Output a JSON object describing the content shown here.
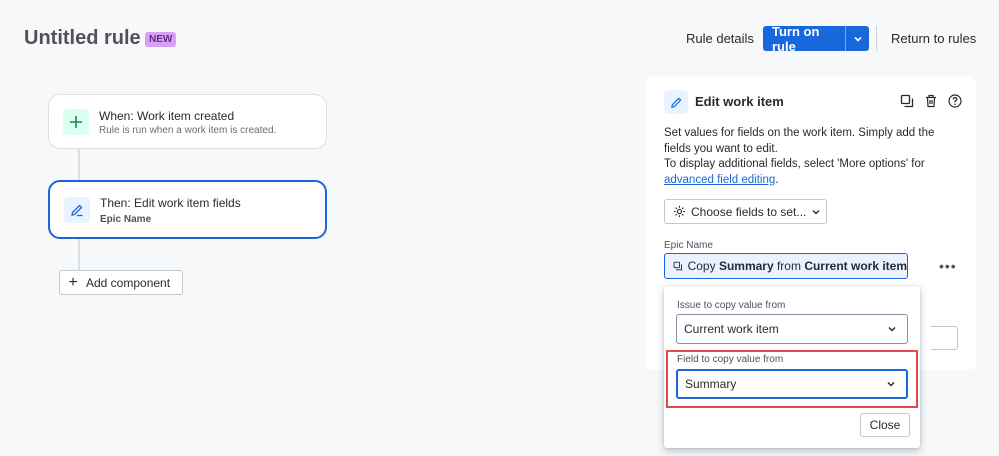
{
  "header": {
    "title": "Untitled rule",
    "badge": "NEW",
    "rule_details": "Rule details",
    "turn_on": "Turn on rule",
    "return": "Return to rules"
  },
  "flow": {
    "trigger": {
      "title": "When: Work item created",
      "subtitle": "Rule is run when a work item is created.",
      "icon": "plus-icon"
    },
    "action": {
      "title": "Then: Edit work item fields",
      "subtitle": "Epic Name",
      "icon": "edit-icon"
    },
    "add_component": "Add component"
  },
  "panel": {
    "title": "Edit work item",
    "desc_line1": "Set values for fields on the work item. Simply add the fields you want to edit.",
    "desc_line2": "To display additional fields, select 'More options' for",
    "desc_link": "advanced field editing",
    "desc_end": ".",
    "choose_fields": "Choose fields to set...",
    "field_label": "Epic Name",
    "copy_prefix": "Copy ",
    "copy_field": "Summary",
    "copy_mid": " from ",
    "copy_source": "Current work item"
  },
  "popup": {
    "issue_label": "Issue to copy value from",
    "issue_value": "Current work item",
    "field_label": "Field to copy value from",
    "field_value": "Summary",
    "close": "Close"
  },
  "colors": {
    "primary": "#1868db",
    "highlight": "#e0494d",
    "badge": "#d8a0f7"
  }
}
